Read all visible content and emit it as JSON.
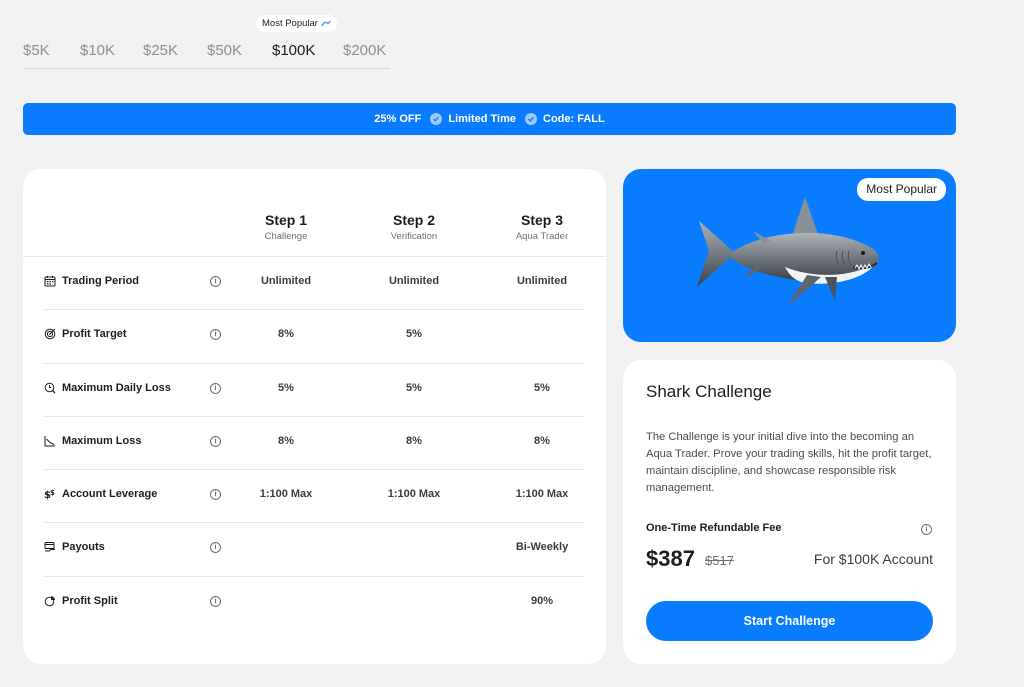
{
  "tabs": {
    "items": [
      "$5K",
      "$10K",
      "$25K",
      "$50K",
      "$100K",
      "$200K"
    ],
    "active": "$100K",
    "popular_label": "Most Popular"
  },
  "promo": {
    "discount": "25% OFF",
    "limited": "Limited Time",
    "code": "Code: FALL"
  },
  "table": {
    "steps": [
      {
        "title": "Step 1",
        "subtitle": "Challenge"
      },
      {
        "title": "Step 2",
        "subtitle": "Verification"
      },
      {
        "title": "Step 3",
        "subtitle": "Aqua Trader"
      }
    ],
    "rows": [
      {
        "label": "Trading Period",
        "icon": "calendar-icon",
        "values": [
          "Unlimited",
          "Unlimited",
          "Unlimited"
        ]
      },
      {
        "label": "Profit Target",
        "icon": "target-icon",
        "values": [
          "8%",
          "5%",
          ""
        ]
      },
      {
        "label": "Maximum Daily Loss",
        "icon": "loss-clock-icon",
        "values": [
          "5%",
          "5%",
          "5%"
        ]
      },
      {
        "label": "Maximum Loss",
        "icon": "chart-down-icon",
        "values": [
          "8%",
          "8%",
          "8%"
        ]
      },
      {
        "label": "Account Leverage",
        "icon": "dollar-icon",
        "values": [
          "1:100 Max",
          "1:100 Max",
          "1:100 Max"
        ]
      },
      {
        "label": "Payouts",
        "icon": "payout-icon",
        "values": [
          "",
          "",
          "Bi-Weekly"
        ]
      },
      {
        "label": "Profit Split",
        "icon": "pie-icon",
        "values": [
          "",
          "",
          "90%"
        ]
      }
    ]
  },
  "image_card": {
    "badge": "Most Popular",
    "image": "shark-illustration"
  },
  "challenge": {
    "title": "Shark Challenge",
    "description": "The Challenge is your initial dive into the becoming an Aqua Trader. Prove your trading skills, hit the profit target, maintain discipline, and showcase responsible risk management.",
    "fee_label": "One-Time Refundable Fee",
    "price": "$387",
    "old_price": "$517",
    "account_label": "For $100K Account",
    "cta": "Start Challenge"
  },
  "colors": {
    "accent": "#0a7cff",
    "background": "#f1f1f2",
    "card": "#ffffff"
  }
}
